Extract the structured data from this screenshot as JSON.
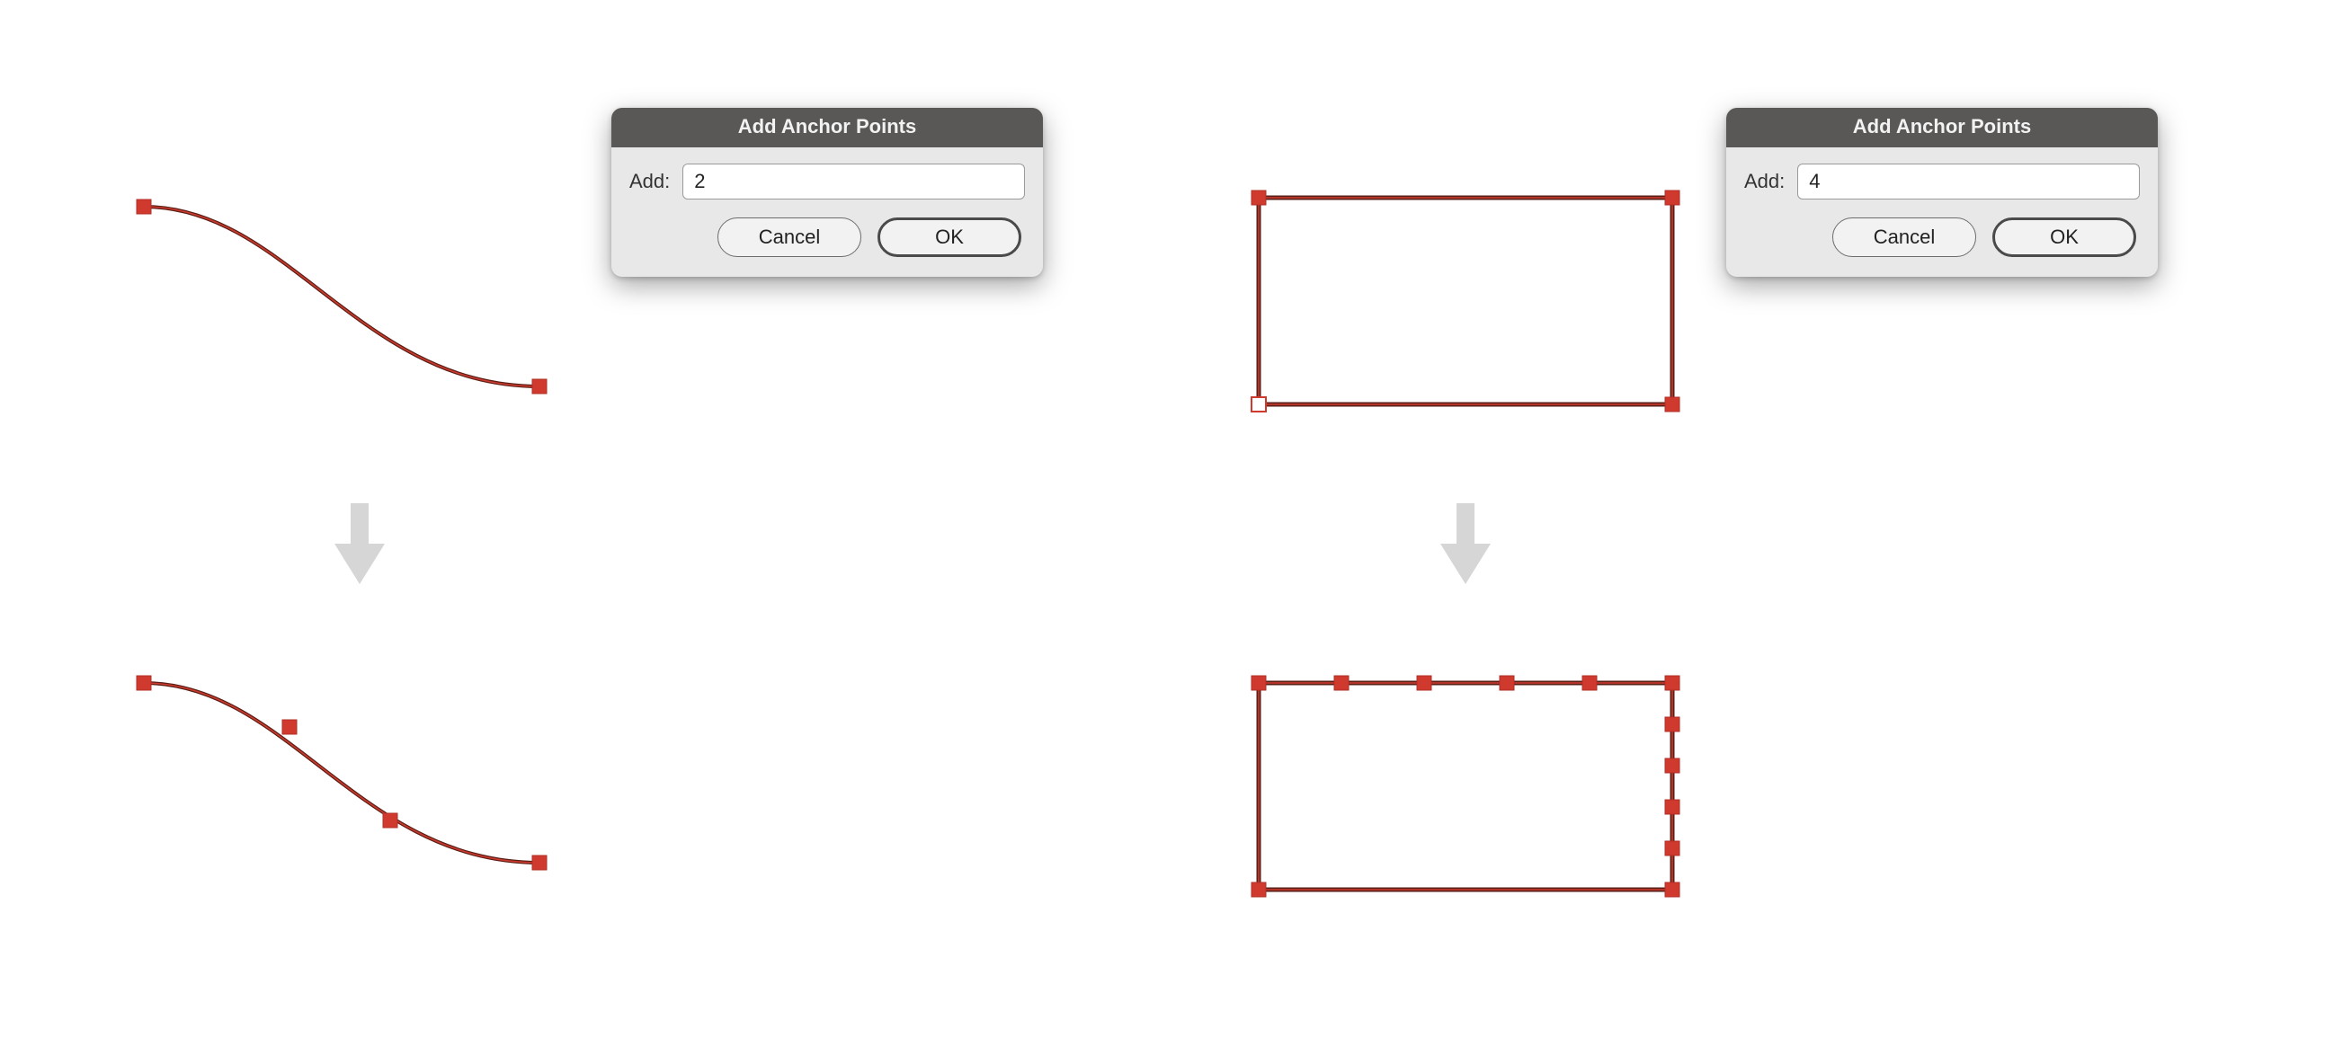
{
  "dialogs": {
    "left": {
      "title": "Add Anchor Points",
      "field_label": "Add:",
      "value": "2",
      "cancel_label": "Cancel",
      "ok_label": "OK"
    },
    "right": {
      "title": "Add Anchor Points",
      "field_label": "Add:",
      "value": "4",
      "cancel_label": "Cancel",
      "ok_label": "OK"
    }
  },
  "colors": {
    "anchor_fill": "#d03a2e",
    "anchor_stroke": "#b22f25",
    "path_stroke_dark": "#5a1f16",
    "dialog_title_bg": "#595856",
    "dialog_bg": "#e8e8e8",
    "arrow_fill": "#d6d6d6"
  }
}
